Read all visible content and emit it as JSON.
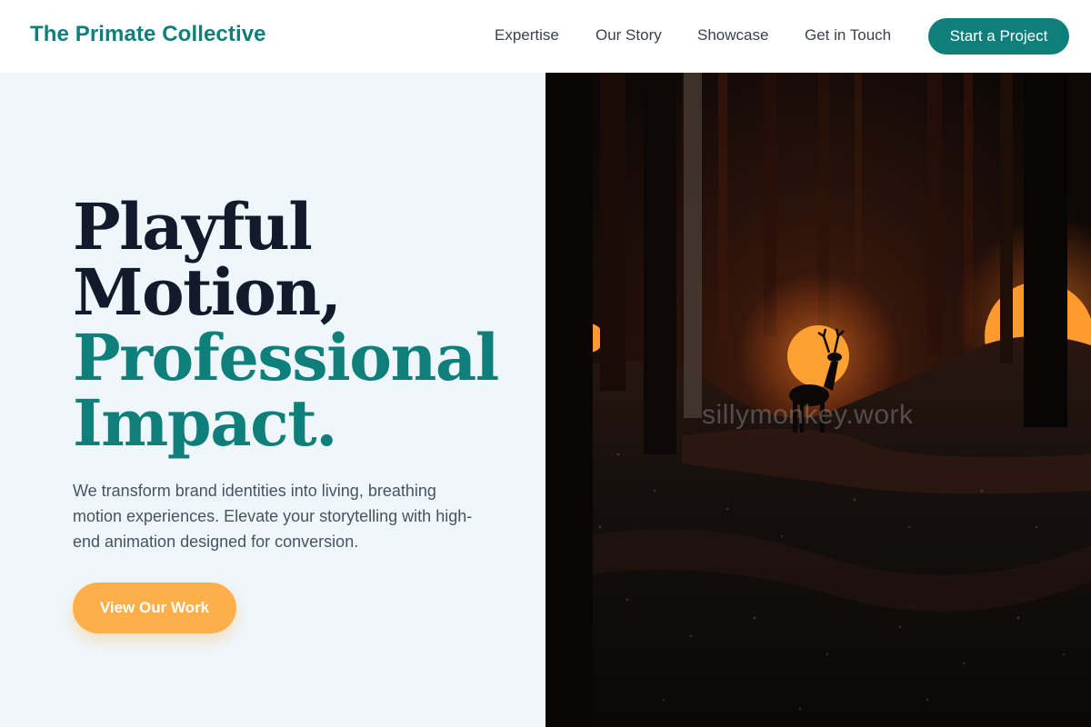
{
  "header": {
    "brand": "The Primate Collective",
    "nav": [
      "Expertise",
      "Our Story",
      "Showcase",
      "Get in Touch"
    ],
    "cta_label": "Start a Project"
  },
  "hero": {
    "headline_line1": "Playful",
    "headline_line2": "Motion,",
    "headline_line3": "Professional",
    "headline_line4": "Impact.",
    "description": "We transform brand identities into living, breathing motion experiences. Elevate your storytelling with high-end animation designed for conversion.",
    "button_label": "View Our Work",
    "image_watermark": "sillymonkey.work"
  },
  "colors": {
    "brand_teal": "#0f7f7b",
    "headline_dark": "#131a2c",
    "accent_orange": "#fdb04a",
    "hero_background": "#eff7fd"
  }
}
